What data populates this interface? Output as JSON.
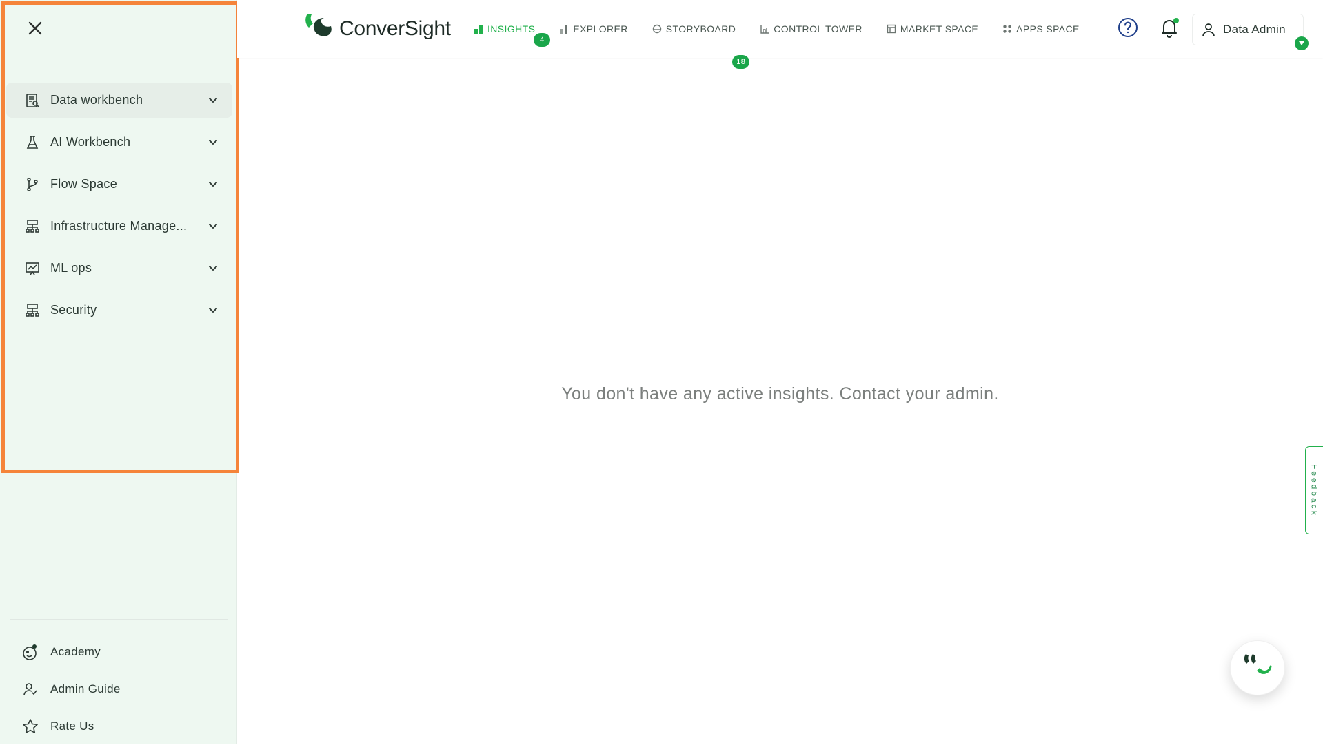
{
  "colors": {
    "accent": "#22b14c",
    "badge": "#1aa64a",
    "sidebar_bg": "#eef8f1",
    "highlight": "#f5843a",
    "brand_dark": "#1e3b2c"
  },
  "brand": {
    "name": "ConverSight",
    "icon": "conversight-logo"
  },
  "topnav": {
    "tabs": [
      {
        "label": "INSIGHTS",
        "icon": "bar-chart-icon",
        "badge": "4",
        "active": true
      },
      {
        "label": "EXPLORER",
        "icon": "bar-chart-icon",
        "badge": "",
        "active": false
      },
      {
        "label": "STORYBOARD",
        "icon": "storyboard-icon",
        "badge": "18",
        "active": false
      },
      {
        "label": "CONTROL TOWER",
        "icon": "tower-icon",
        "badge": "",
        "active": false
      },
      {
        "label": "MARKET SPACE",
        "icon": "market-icon",
        "badge": "",
        "active": false
      },
      {
        "label": "APPS SPACE",
        "icon": "apps-grid-icon",
        "badge": "",
        "active": false
      }
    ],
    "help_icon": "help-circle-icon",
    "notification_icon": "bell-icon",
    "user": {
      "name": "Data Admin",
      "icon": "user-icon"
    }
  },
  "sidebar": {
    "close_icon": "close-icon",
    "items": [
      {
        "label": "Data workbench",
        "icon": "data-workbench-icon",
        "active": true
      },
      {
        "label": "AI Workbench",
        "icon": "flask-icon",
        "active": false
      },
      {
        "label": "Flow Space",
        "icon": "branch-icon",
        "active": false
      },
      {
        "label": "Infrastructure Manage...",
        "icon": "hierarchy-icon",
        "active": false
      },
      {
        "label": "ML ops",
        "icon": "presentation-chart-icon",
        "active": false
      },
      {
        "label": "Security",
        "icon": "hierarchy-icon",
        "active": false
      }
    ],
    "footer": [
      {
        "label": "Academy",
        "icon": "academy-icon"
      },
      {
        "label": "Admin Guide",
        "icon": "admin-guide-icon"
      },
      {
        "label": "Rate Us",
        "icon": "star-icon"
      }
    ]
  },
  "main": {
    "empty_message": "You don't have any active insights. Contact your admin."
  },
  "feedback": {
    "label": "Feedback"
  }
}
